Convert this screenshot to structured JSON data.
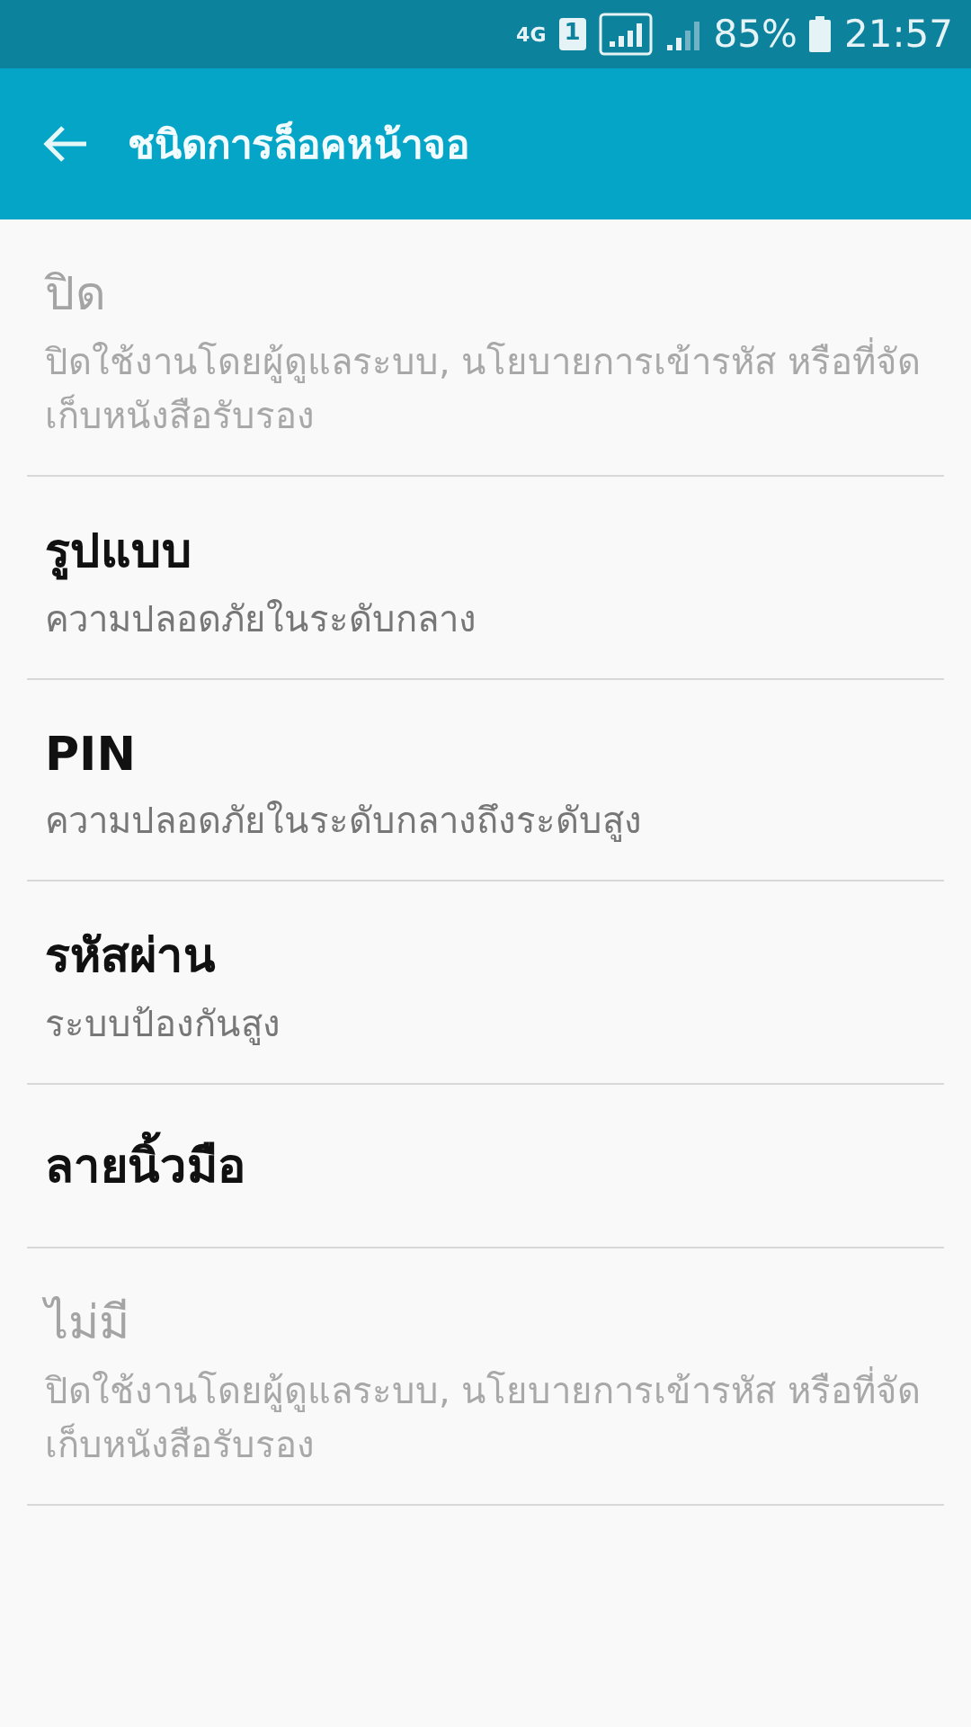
{
  "status_bar": {
    "network": "4G",
    "sim": "1",
    "battery": "85%",
    "time": "21:57"
  },
  "app_bar": {
    "title": "ชนิดการล็อคหน้าจอ"
  },
  "options": [
    {
      "title": "ปิด",
      "subtitle": "ปิดใช้งานโดยผู้ดูแลระบบ, นโยบายการเข้ารหัส หรือที่จัดเก็บหนังสือรับรอง",
      "disabled": true
    },
    {
      "title": "รูปแบบ",
      "subtitle": "ความปลอดภัยในระดับกลาง",
      "disabled": false
    },
    {
      "title": "PIN",
      "subtitle": "ความปลอดภัยในระดับกลางถึงระดับสูง",
      "disabled": false
    },
    {
      "title": "รหัสผ่าน",
      "subtitle": "ระบบป้องกันสูง",
      "disabled": false
    },
    {
      "title": "ลายนิ้วมือ",
      "disabled": false
    },
    {
      "title": "ไม่มี",
      "subtitle": "ปิดใช้งานโดยผู้ดูแลระบบ, นโยบายการเข้ารหัส หรือที่จัดเก็บหนังสือรับรอง",
      "disabled": true
    }
  ]
}
